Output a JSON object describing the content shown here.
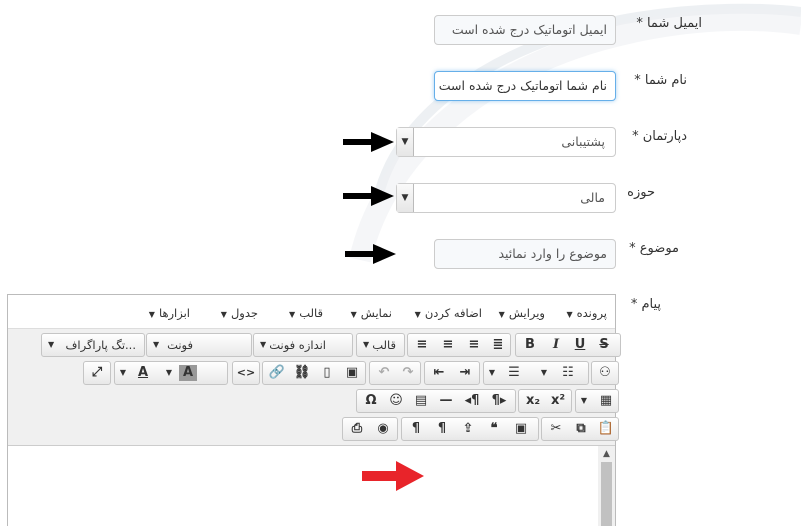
{
  "form": {
    "email_label": "ایمیل شما *",
    "email_value": "ایمیل اتوماتیک درج شده است",
    "name_label": "نام شما *",
    "name_value": "نام شما اتوماتیک درج شده است",
    "department_label": "دپارتمان *",
    "department_value": "پشتیبانی",
    "area_label": "حوزه",
    "area_value": "مالی",
    "subject_label": "موضوع *",
    "subject_placeholder": "موضوع را وارد نمائید",
    "message_label": "پیام *"
  },
  "editor": {
    "menus": [
      "پرونده",
      "ویرایش",
      "اضافه کردن",
      "نمایش",
      "قالب",
      "جدول",
      "ابزارها"
    ],
    "dropdowns": {
      "paragraph_tag": "...تگ پاراگراف",
      "font": "فونت",
      "font_size": "اندازه فونت",
      "format": "قالب"
    },
    "text_color_label": "A",
    "bg_color_label": "A"
  },
  "annotations": {
    "black_arrow_color": "#000000",
    "red_arrow_color": "#e8242a"
  }
}
